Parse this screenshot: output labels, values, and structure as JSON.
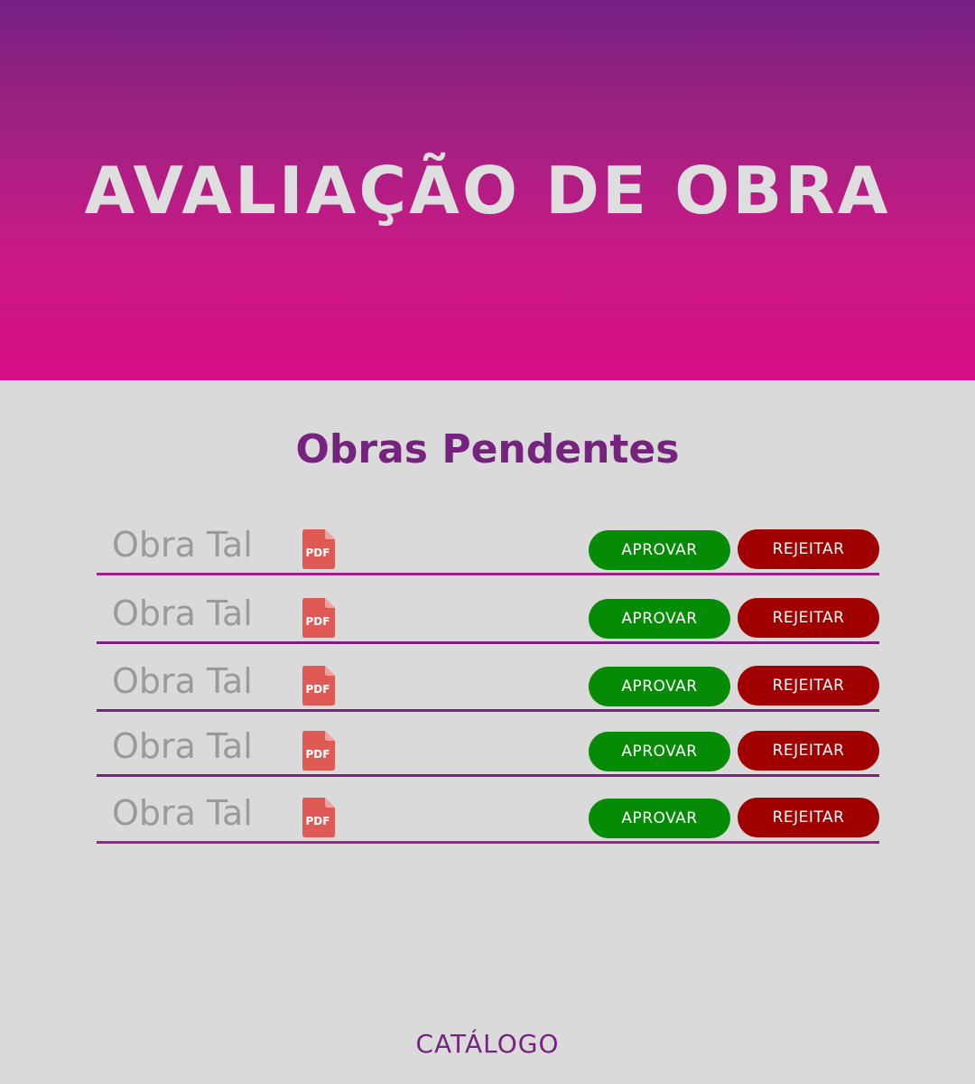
{
  "header": {
    "title": "AVALIAÇÃO DE OBRA"
  },
  "main": {
    "section_title": "Obras Pendentes",
    "pdf_icon_label": "PDF",
    "works": [
      {
        "name": "Obra Tal",
        "approve_label": "APROVAR",
        "reject_label": "REJEITAR"
      },
      {
        "name": "Obra Tal",
        "approve_label": "APROVAR",
        "reject_label": "REJEITAR"
      },
      {
        "name": "Obra Tal",
        "approve_label": "APROVAR",
        "reject_label": "REJEITAR"
      },
      {
        "name": "Obra Tal",
        "approve_label": "APROVAR",
        "reject_label": "REJEITAR"
      },
      {
        "name": "Obra Tal",
        "approve_label": "APROVAR",
        "reject_label": "REJEITAR"
      }
    ]
  },
  "footer": {
    "catalog_label": "CATÁLOGO"
  },
  "colors": {
    "header_gradient_top": "#761f83",
    "header_gradient_bottom": "#d80d85",
    "accent_purple": "#75237e",
    "approve_green": "#058b05",
    "reject_red": "#a00000",
    "pdf_red": "#e05a55",
    "background": "#dadada"
  },
  "icons": {
    "pdf": "pdf-file-icon"
  }
}
